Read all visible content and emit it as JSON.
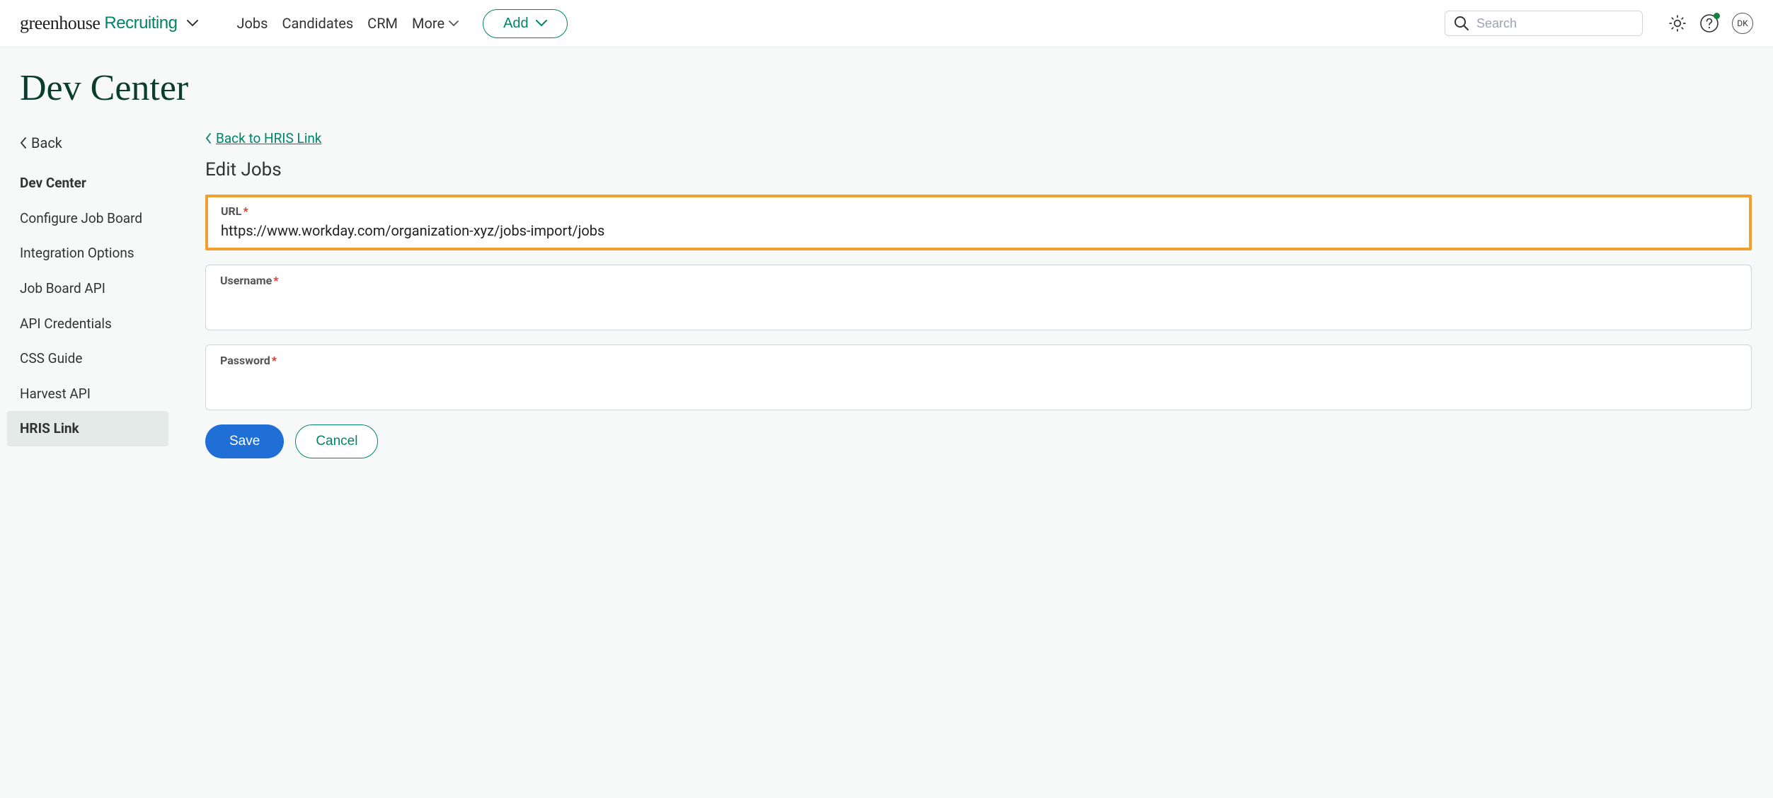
{
  "logo": {
    "word1": "greenhouse",
    "word2": "Recruiting"
  },
  "nav": {
    "jobs": "Jobs",
    "candidates": "Candidates",
    "crm": "CRM",
    "more": "More"
  },
  "add_button": "Add",
  "search": {
    "placeholder": "Search"
  },
  "avatar_initials": "DK",
  "page_title": "Dev Center",
  "sidebar": {
    "back": "Back",
    "items": [
      {
        "label": "Dev Center",
        "active_parent": true
      },
      {
        "label": "Configure Job Board"
      },
      {
        "label": "Integration Options"
      },
      {
        "label": "Job Board API"
      },
      {
        "label": "API Credentials"
      },
      {
        "label": "CSS Guide"
      },
      {
        "label": "Harvest API"
      },
      {
        "label": "HRIS Link",
        "selected": true
      }
    ]
  },
  "main": {
    "breadcrumb_back": "Back to HRIS Link",
    "form_title": "Edit Jobs",
    "fields": {
      "url": {
        "label": "URL",
        "required": true,
        "value": "https://www.workday.com/organization-xyz/jobs-import/jobs",
        "highlighted": true
      },
      "username": {
        "label": "Username",
        "required": true,
        "value": ""
      },
      "password": {
        "label": "Password",
        "required": true,
        "value": ""
      }
    },
    "buttons": {
      "save": "Save",
      "cancel": "Cancel"
    }
  }
}
